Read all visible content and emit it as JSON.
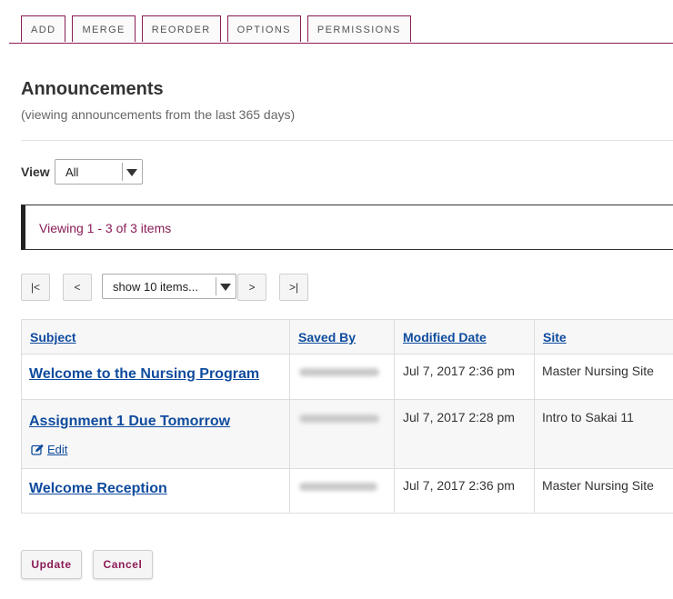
{
  "toolbar": {
    "tabs": [
      {
        "label": "ADD"
      },
      {
        "label": "MERGE"
      },
      {
        "label": "REORDER"
      },
      {
        "label": "OPTIONS"
      },
      {
        "label": "PERMISSIONS"
      }
    ]
  },
  "header": {
    "title": "Announcements",
    "subtitle": "(viewing announcements from the last 365 days)"
  },
  "view": {
    "label": "View",
    "selected": "All"
  },
  "info": {
    "message": "Viewing 1 - 3 of 3 items"
  },
  "pager": {
    "first": "|<",
    "prev": "<",
    "page_size": "show 10 items...",
    "next": ">",
    "last": ">|"
  },
  "table": {
    "headers": {
      "subject": "Subject",
      "saved_by": "Saved By",
      "modified_date": "Modified Date",
      "site": "Site"
    },
    "rows": [
      {
        "subject": "Welcome to the Nursing Program",
        "modified": "Jul 7, 2017 2:36 pm",
        "site": "Master Nursing Site"
      },
      {
        "subject": "Assignment 1 Due Tomorrow",
        "modified": "Jul 7, 2017 2:28 pm",
        "site": "Intro to Sakai 11",
        "edit_label": "Edit"
      },
      {
        "subject": "Welcome Reception",
        "modified": "Jul 7, 2017 2:36 pm",
        "site": "Master Nursing Site"
      }
    ]
  },
  "actions": {
    "update": "Update",
    "cancel": "Cancel"
  },
  "colors": {
    "accent": "#8a1c56",
    "link": "#0f4b9d"
  }
}
